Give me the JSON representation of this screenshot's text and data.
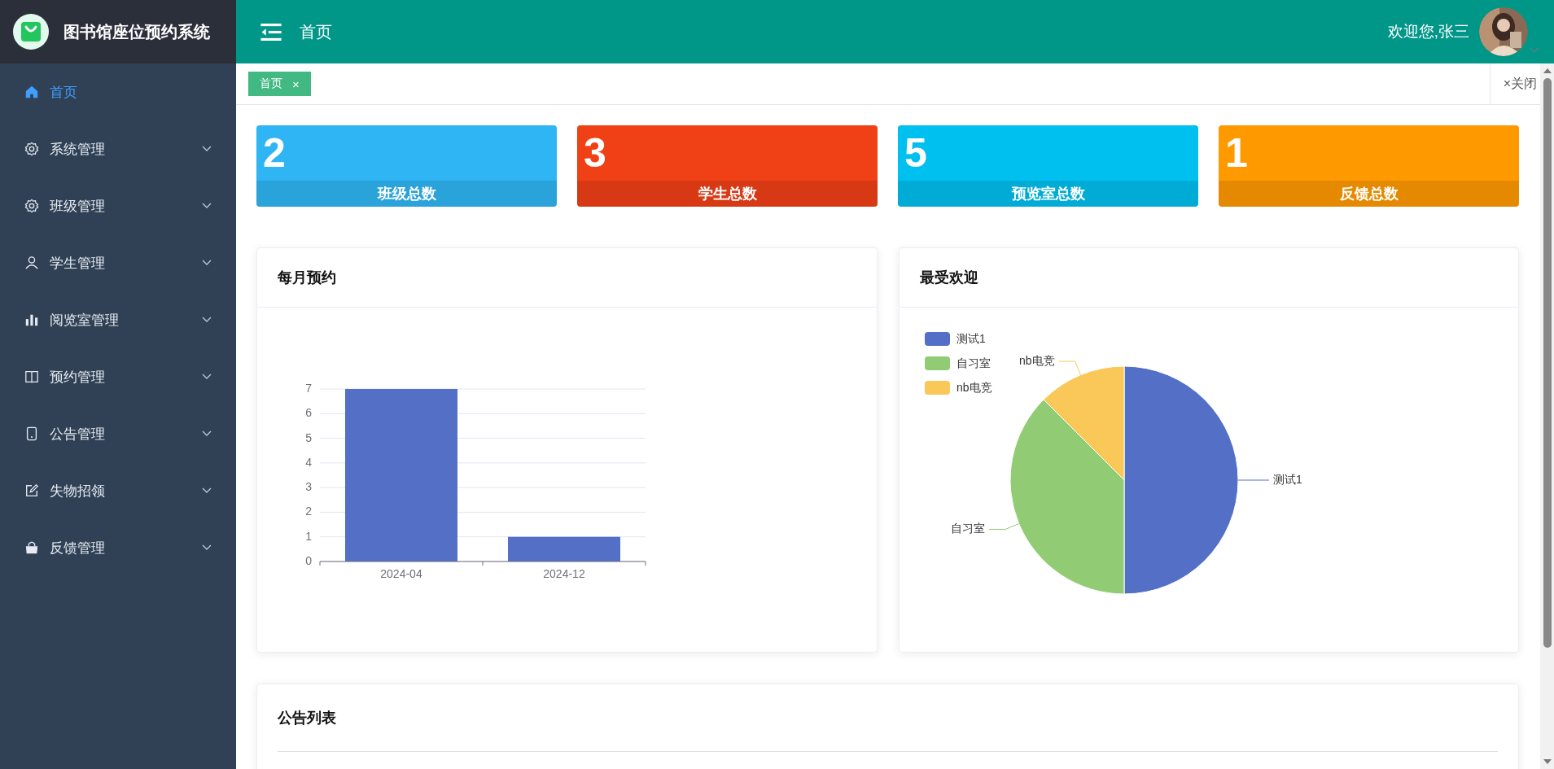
{
  "header": {
    "title": "图书馆座位预约系统",
    "page_title": "首页",
    "welcome": "欢迎您,张三"
  },
  "sidebar": {
    "items": [
      {
        "label": "首页",
        "kind": "link",
        "selected": true
      },
      {
        "label": "系统管理",
        "kind": "submenu",
        "selected": false,
        "expanded": false
      },
      {
        "label": "班级管理",
        "kind": "submenu",
        "selected": false,
        "expanded": false
      },
      {
        "label": "学生管理",
        "kind": "submenu",
        "selected": false,
        "expanded": false
      },
      {
        "label": "阅览室管理",
        "kind": "submenu",
        "selected": false,
        "expanded": false
      },
      {
        "label": "预约管理",
        "kind": "submenu",
        "selected": false,
        "expanded": false
      },
      {
        "label": "公告管理",
        "kind": "submenu",
        "selected": false,
        "expanded": false
      },
      {
        "label": "失物招领",
        "kind": "submenu",
        "selected": false,
        "expanded": false
      },
      {
        "label": "反馈管理",
        "kind": "submenu",
        "selected": false,
        "expanded": false
      }
    ]
  },
  "tabs": [
    {
      "label": "首页",
      "close": "×",
      "selected": true
    }
  ],
  "close_all": "×关闭",
  "stats": [
    {
      "value": "2",
      "label": "班级总数",
      "color": "#2fb5f3"
    },
    {
      "value": "3",
      "label": "学生总数",
      "color": "#ef4016"
    },
    {
      "value": "5",
      "label": "预览室总数",
      "color": "#00c0ef"
    },
    {
      "value": "1",
      "label": "反馈总数",
      "color": "#ff9900"
    }
  ],
  "monthly": {
    "title": "每月预约",
    "chart_data": {
      "type": "bar",
      "categories": [
        "2024-04",
        "2024-12"
      ],
      "series": [
        {
          "color": "#5470c6",
          "values": [
            7,
            1
          ]
        }
      ],
      "grid": true,
      "ylim": [
        0,
        7
      ],
      "yticks": [
        0,
        1,
        2,
        3,
        4,
        5,
        6,
        7
      ]
    }
  },
  "popular": {
    "title": "最受欢迎",
    "chart_data": {
      "type": "pie",
      "categories": [
        "测试1",
        "自习室",
        "nb电竞"
      ],
      "series": [
        {
          "values": [
            50,
            37.5,
            12.5
          ]
        }
      ],
      "legend": true,
      "colors": [
        "#5470c6",
        "#91cc75",
        "#fac858"
      ]
    }
  },
  "notices": {
    "title": "公告列表"
  }
}
